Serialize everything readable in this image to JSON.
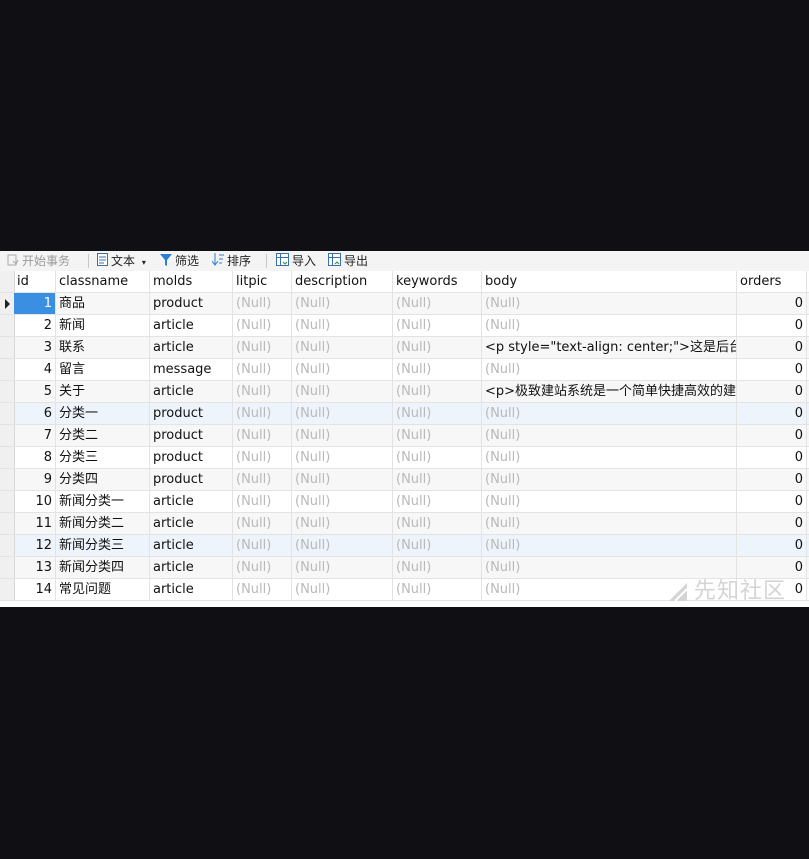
{
  "toolbar": {
    "begin_transaction": "开始事务",
    "text": "文本",
    "filter": "筛选",
    "sort": "排序",
    "import": "导入",
    "export": "导出"
  },
  "columns": [
    "id",
    "classname",
    "molds",
    "litpic",
    "description",
    "keywords",
    "body",
    "orders"
  ],
  "rows": [
    [
      "1",
      "商品",
      "product",
      "(Null)",
      "(Null)",
      "(Null)",
      "(Null)",
      "0"
    ],
    [
      "2",
      "新闻",
      "article",
      "(Null)",
      "(Null)",
      "(Null)",
      "(Null)",
      "0"
    ],
    [
      "3",
      "联系",
      "article",
      "(Null)",
      "(Null)",
      "(Null)",
      "<p style=\"text-align: center;\">这是后台",
      "0"
    ],
    [
      "4",
      "留言",
      "message",
      "(Null)",
      "(Null)",
      "(Null)",
      "(Null)",
      "0"
    ],
    [
      "5",
      "关于",
      "article",
      "(Null)",
      "(Null)",
      "(Null)",
      "<p>极致建站系统是一个简单快捷高效的建",
      "0"
    ],
    [
      "6",
      "分类一",
      "product",
      "(Null)",
      "(Null)",
      "(Null)",
      "(Null)",
      "0"
    ],
    [
      "7",
      "分类二",
      "product",
      "(Null)",
      "(Null)",
      "(Null)",
      "(Null)",
      "0"
    ],
    [
      "8",
      "分类三",
      "product",
      "(Null)",
      "(Null)",
      "(Null)",
      "(Null)",
      "0"
    ],
    [
      "9",
      "分类四",
      "product",
      "(Null)",
      "(Null)",
      "(Null)",
      "(Null)",
      "0"
    ],
    [
      "10",
      "新闻分类一",
      "article",
      "(Null)",
      "(Null)",
      "(Null)",
      "(Null)",
      "0"
    ],
    [
      "11",
      "新闻分类二",
      "article",
      "(Null)",
      "(Null)",
      "(Null)",
      "(Null)",
      "0"
    ],
    [
      "12",
      "新闻分类三",
      "article",
      "(Null)",
      "(Null)",
      "(Null)",
      "(Null)",
      "0"
    ],
    [
      "13",
      "新闻分类四",
      "article",
      "(Null)",
      "(Null)",
      "(Null)",
      "(Null)",
      "0"
    ],
    [
      "14",
      "常见问题",
      "article",
      "(Null)",
      "(Null)",
      "(Null)",
      "(Null)",
      "0"
    ]
  ],
  "watermark": "先知社区",
  "colors": {
    "selected_cell": "#3b8fe0",
    "null_text": "#b9b9b9",
    "selected_row": "#eef4fb"
  }
}
